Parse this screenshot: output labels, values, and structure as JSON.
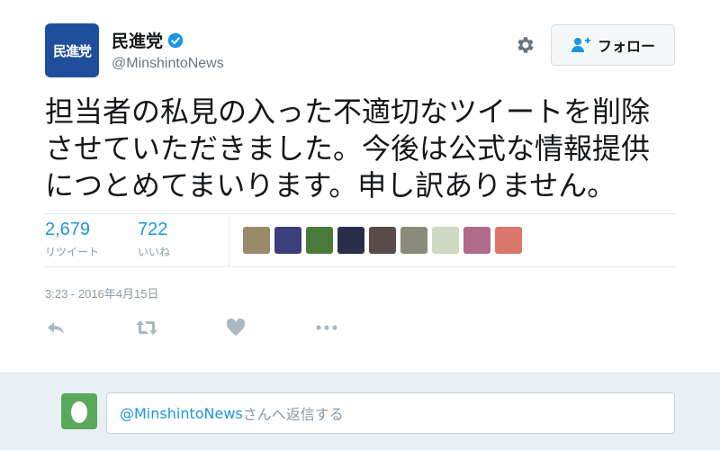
{
  "author": {
    "avatar_text": "民進党",
    "display_name": "民進党",
    "handle": "@MinshintoNews",
    "verified": true
  },
  "follow_button_label": "フォロー",
  "tweet": {
    "lines": [
      "担当者の私見の入った不適切なツイートを削除",
      "させていただきました。今後は公式な情報提供",
      "につとめてまいります。申し訳ありません。"
    ]
  },
  "stats": {
    "retweets": {
      "count": "2,679",
      "label": "リツイート"
    },
    "likes": {
      "count": "722",
      "label": "いいね"
    }
  },
  "likers": [
    {
      "color": "#9a8a6a"
    },
    {
      "color": "#3b3f7a"
    },
    {
      "color": "#4a7a3a"
    },
    {
      "color": "#2a2e4a"
    },
    {
      "color": "#5a4a4a"
    },
    {
      "color": "#8a8a7a"
    },
    {
      "color": "#cfd8c0"
    },
    {
      "color": "#b06a8a"
    },
    {
      "color": "#d9776a"
    }
  ],
  "timestamp": "3:23 - 2016年4月15日",
  "reply": {
    "mention": "@MinshintoNews",
    "placeholder_suffix": "さんへ返信する"
  },
  "colors": {
    "link": "#1b95e0",
    "avatar_bg": "#1f4e9c",
    "icon_gray": "#657786"
  }
}
